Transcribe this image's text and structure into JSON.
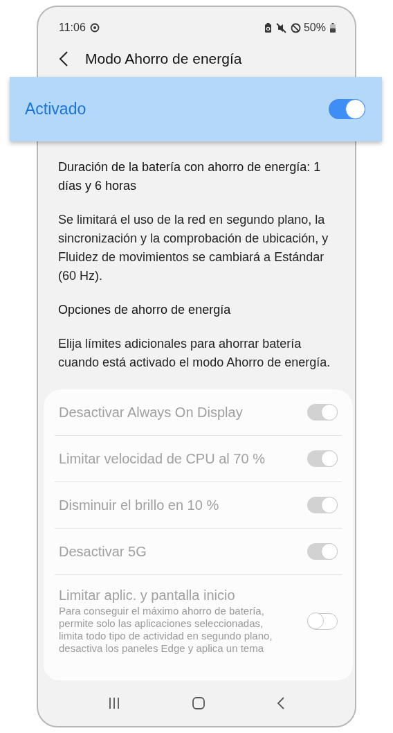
{
  "status_bar": {
    "time": "11:06",
    "battery": "50%"
  },
  "header": {
    "title": "Modo Ahorro de energía"
  },
  "master_switch": {
    "label": "Activado",
    "on": true
  },
  "battery_duration": "Duración de la batería con ahorro de energía: 1 días y 6 horas",
  "description": "Se limitará el uso de la red en segundo plano, la sincronización y la comprobación de ubicación, y Fluidez de movimientos se cambiará a Estándar (60 Hz).",
  "options_heading": "Opciones de ahorro de energía",
  "options_description": "Elija límites adicionales para ahorrar batería cuando está activado el modo Ahorro de energía.",
  "options": [
    {
      "label": "Desactivar Always On Display",
      "on": true,
      "disabled": true
    },
    {
      "label": "Limitar velocidad de CPU al 70 %",
      "on": true,
      "disabled": true
    },
    {
      "label": "Disminuir el brillo en 10 %",
      "on": true,
      "disabled": true
    },
    {
      "label": "Desactivar 5G",
      "on": true,
      "disabled": true
    },
    {
      "label": "Limitar aplic. y pantalla inicio",
      "description": "Para conseguir el máximo ahorro de batería, permite solo las aplicaciones seleccionadas, limita todo tipo de actividad en segundo plano, desactiva los paneles Edge y aplica un tema",
      "on": false,
      "disabled": true
    }
  ]
}
